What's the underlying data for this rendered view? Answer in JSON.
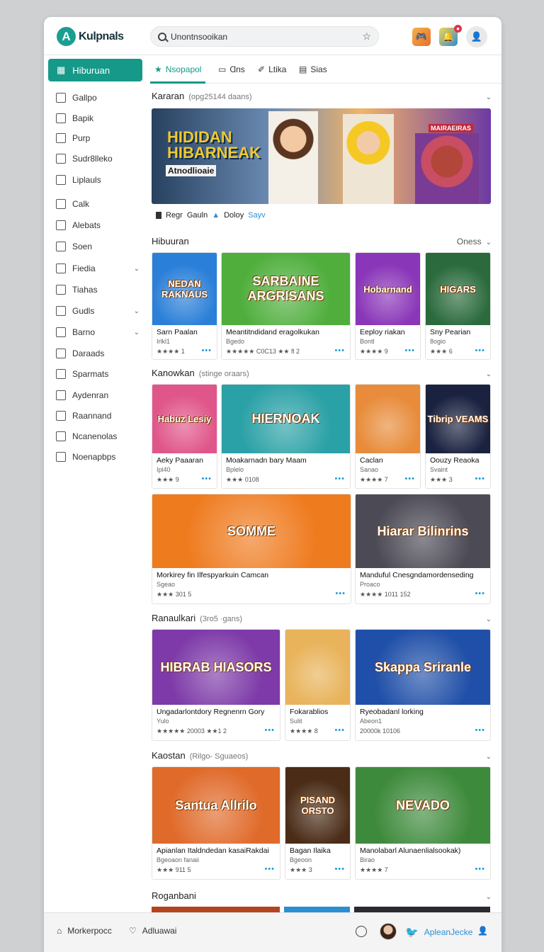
{
  "app": {
    "logo_text": "Kulpnals",
    "logo_mark": "A"
  },
  "search": {
    "value": "Unontnsooikan"
  },
  "sidebar": {
    "active": "Hiburuan",
    "items": [
      {
        "label": "Gallpo",
        "chev": false
      },
      {
        "label": "Bapik",
        "chev": false
      },
      {
        "label": "Purp",
        "chev": false
      },
      {
        "label": "Sudr8lleko",
        "chev": false
      },
      {
        "label": "Liplauls",
        "chev": false
      },
      {
        "label": "Calk",
        "chev": false
      },
      {
        "label": "Alebats",
        "chev": false
      },
      {
        "label": "Soen",
        "chev": false
      },
      {
        "label": "Fiedia",
        "chev": true
      },
      {
        "label": "Tiahas",
        "chev": false
      },
      {
        "label": "Gudls",
        "chev": true
      },
      {
        "label": "Barno",
        "chev": true
      },
      {
        "label": "Daraads",
        "chev": false
      },
      {
        "label": "Sparmats",
        "chev": false
      },
      {
        "label": "Aydenran",
        "chev": false
      },
      {
        "label": "Raannand",
        "chev": false
      },
      {
        "label": "Ncanenolas",
        "chev": false
      },
      {
        "label": "Noenapbps",
        "chev": false
      }
    ]
  },
  "tabs": [
    "Nsopapol",
    "Ɑns",
    "Ltika",
    "Sias"
  ],
  "sections": {
    "s1": {
      "title": "Kararan",
      "sub": "(opg25144 daans)"
    },
    "s2": {
      "title": "Hibuuran",
      "right": "Oness"
    },
    "s3": {
      "title": "Kanowkan",
      "sub": "(stinge oraars)"
    },
    "s4": {
      "title": "Ranaulkari",
      "sub": "(3ro5 ·gans)"
    },
    "s5": {
      "title": "Kaostan",
      "sub": "(Rilgo- Sguaeos)"
    },
    "s6": {
      "title": "Roganbani"
    }
  },
  "hero": {
    "title_1": "HIDIDAN",
    "title_2": "HIBARNEAK",
    "subtitle": "Atnodlioaie",
    "badge": "MAIRAEIRAS",
    "cap_1": "Regr",
    "cap_2": "Gauln",
    "cap_3": "Doloy",
    "cap_4": "Sayv"
  },
  "cards": [
    {
      "art": "NEDAN RAKNAUS",
      "title": "Sarn Paalan",
      "sub": "Irlkl1",
      "rating": "★★★★ 1",
      "bg": "#2a7fd8"
    },
    {
      "art": "SARBAINE ARGRISANS",
      "title": "Meantitndidand eragolkukan",
      "sub": "Bgedo",
      "rating": "★★★★★ C0C13  ★★ fl 2",
      "bg": "#4fae3c"
    },
    {
      "art": "Hobarnand",
      "title": "Eeploy riakan",
      "sub": "Bontl",
      "rating": "★★★★ 9",
      "bg": "#8a36b8"
    },
    {
      "art": "HIGARS",
      "title": "Sny Pearian",
      "sub": "8ogio",
      "rating": "★★★ 6",
      "bg": "#2a6a3c"
    },
    {
      "art": "Habuz Lesiy",
      "title": "Aeky Paaaran",
      "sub": "Ipl40",
      "rating": "★★★ 9",
      "bg": "#e0568a"
    },
    {
      "art": "HIERNOAK",
      "title": "Moakarnadn bary Maam",
      "sub": "Bplelo",
      "rating": "★★★ 0108",
      "bg": "#2aa1a6"
    },
    {
      "art": "",
      "title": "Caclan",
      "sub": "Sanao",
      "rating": "★★★★ 7",
      "bg": "#e88c3b"
    },
    {
      "art": "Tibrip VEAMS",
      "title": "Oouzy Reaoka",
      "sub": "Svaint",
      "rating": "★★★ 3",
      "bg": "#1a2240"
    },
    {
      "art": "SOMME",
      "title": "Morkirey fin Ilfespyarkuin Camcan",
      "sub": "Sgeao",
      "rating": "★★★ 301 5",
      "bg": "#ef7b1f"
    },
    {
      "art": "Hiarar Bilinrins",
      "title": "Manduful Cnesgndamordenseding",
      "sub": "Proaco",
      "rating": "★★★★ 1011 152",
      "bg": "#4b4a55"
    },
    {
      "art": "HIBRAB HIASORS",
      "title": "Ungadarlontdory Regnenrn Gory",
      "sub": "Yulo",
      "rating": "★★★★★ 20003  ★★1 2",
      "bg": "#7d3aa8"
    },
    {
      "art": "",
      "title": "Fokarablios",
      "sub": "Sulit",
      "rating": "★★★★ 8",
      "bg": "#e8b35a"
    },
    {
      "art": "Skappa Sriranle",
      "title": "Ryeobadanl lorking",
      "sub": "Abeon1",
      "rating": "20000k 10106",
      "bg": "#1f4fa8"
    },
    {
      "art": "Santua Allrilo",
      "title": "Apianlan Italdndedan kasaiRakdai",
      "sub": "Bgeoaon  fanaii",
      "rating": "★★★ 911 5",
      "bg": "#e06a2a"
    },
    {
      "art": "PISAND ORSTO",
      "title": "Bagan Ilaika",
      "sub": "Bgeoon",
      "rating": "★★★ 3",
      "bg": "#4a2c17"
    },
    {
      "art": "NEVADO",
      "title": "Manolabarl Alunaenlialsookak)",
      "sub": "Birao",
      "rating": "★★★★ 7",
      "bg": "#3e8a3c"
    }
  ],
  "bottombar": {
    "left_1": "Morkerpocc",
    "left_2": "Adluawai",
    "right": "ApleanJecke"
  }
}
